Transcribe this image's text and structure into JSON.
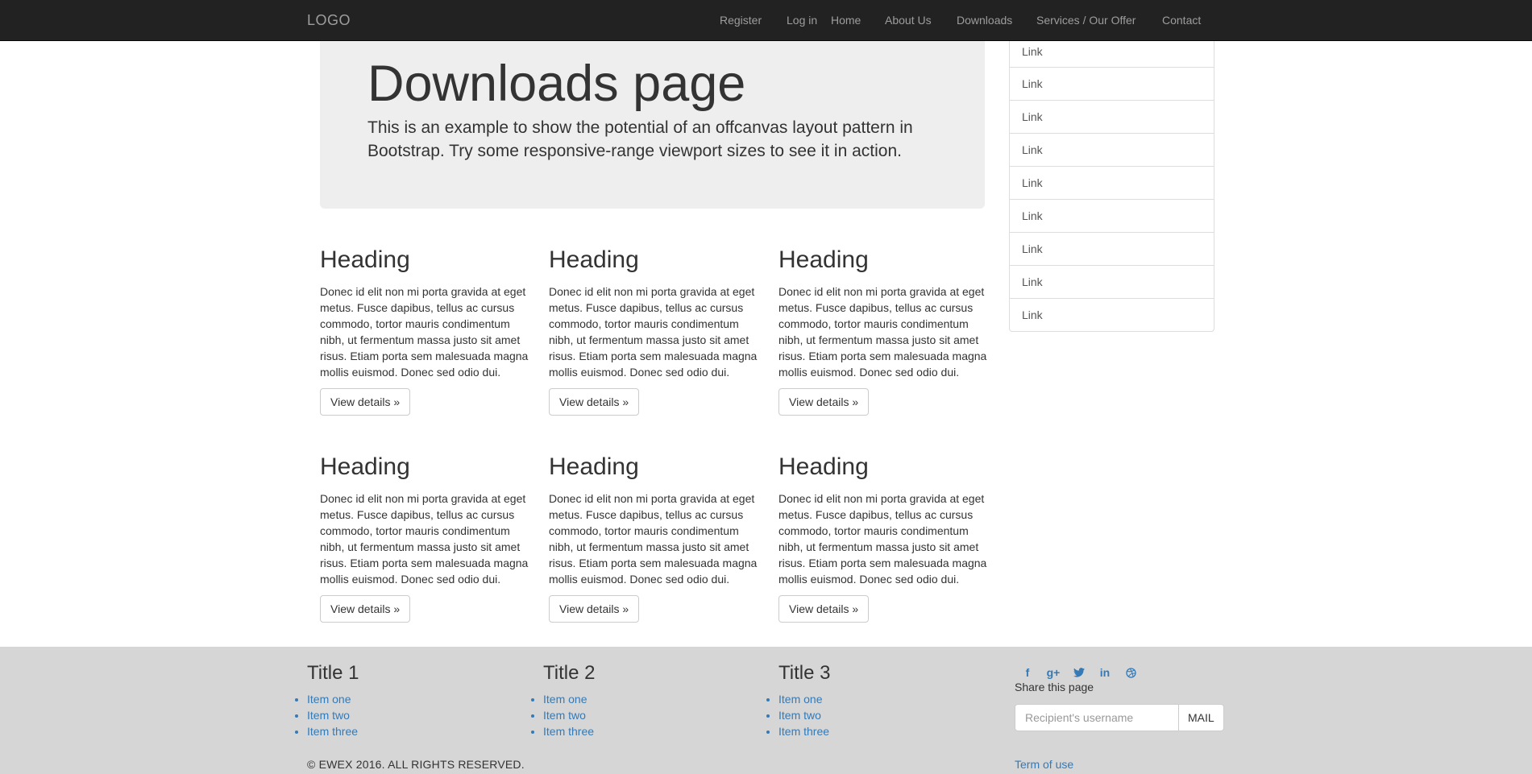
{
  "navbar": {
    "brand": "LOGO",
    "links": [
      "Register",
      "Log in",
      "Home",
      "About Us",
      "Downloads",
      "Services / Our Offer",
      "Contact"
    ]
  },
  "jumbotron": {
    "title": "Downloads page",
    "lead": "This is an example to show the potential of an offcanvas layout pattern in Bootstrap. Try some responsive-range viewport sizes to see it in action."
  },
  "sidebar": {
    "items": [
      "Link",
      "Link",
      "Link",
      "Link",
      "Link",
      "Link",
      "Link",
      "Link",
      "Link"
    ]
  },
  "cards": [
    {
      "heading": "Heading",
      "text": "Donec id elit non mi porta gravida at eget metus. Fusce dapibus, tellus ac cursus commodo, tortor mauris condimentum nibh, ut fermentum massa justo sit amet risus. Etiam porta sem malesuada magna mollis euismod. Donec sed odio dui.",
      "button": "View details »"
    },
    {
      "heading": "Heading",
      "text": "Donec id elit non mi porta gravida at eget metus. Fusce dapibus, tellus ac cursus commodo, tortor mauris condimentum nibh, ut fermentum massa justo sit amet risus. Etiam porta sem malesuada magna mollis euismod. Donec sed odio dui.",
      "button": "View details »"
    },
    {
      "heading": "Heading",
      "text": "Donec id elit non mi porta gravida at eget metus. Fusce dapibus, tellus ac cursus commodo, tortor mauris condimentum nibh, ut fermentum massa justo sit amet risus. Etiam porta sem malesuada magna mollis euismod. Donec sed odio dui.",
      "button": "View details »"
    },
    {
      "heading": "Heading",
      "text": "Donec id elit non mi porta gravida at eget metus. Fusce dapibus, tellus ac cursus commodo, tortor mauris condimentum nibh, ut fermentum massa justo sit amet risus. Etiam porta sem malesuada magna mollis euismod. Donec sed odio dui.",
      "button": "View details »"
    },
    {
      "heading": "Heading",
      "text": "Donec id elit non mi porta gravida at eget metus. Fusce dapibus, tellus ac cursus commodo, tortor mauris condimentum nibh, ut fermentum massa justo sit amet risus. Etiam porta sem malesuada magna mollis euismod. Donec sed odio dui.",
      "button": "View details »"
    },
    {
      "heading": "Heading",
      "text": "Donec id elit non mi porta gravida at eget metus. Fusce dapibus, tellus ac cursus commodo, tortor mauris condimentum nibh, ut fermentum massa justo sit amet risus. Etiam porta sem malesuada magna mollis euismod. Donec sed odio dui.",
      "button": "View details »"
    }
  ],
  "footer": {
    "columns": [
      {
        "title": "Title 1",
        "items": [
          "Item one",
          "Item two",
          "Item three"
        ]
      },
      {
        "title": "Title 2",
        "items": [
          "Item one",
          "Item two",
          "Item three"
        ]
      },
      {
        "title": "Title 3",
        "items": [
          "Item one",
          "Item two",
          "Item three"
        ]
      }
    ],
    "social_icons": [
      "facebook-icon",
      "google-plus-icon",
      "twitter-icon",
      "linkedin-icon",
      "dribbble-icon"
    ],
    "share_label": "Share this page",
    "mail_placeholder": "Recipient's username",
    "mail_button": "MAIL",
    "copyright": "© EWEX 2016. ALL RIGHTS RESERVED.",
    "terms": "Term of use"
  },
  "colors": {
    "navbar_bg": "#222222",
    "nav_text": "#9d9d9d",
    "jumbotron_bg": "#eeeeee",
    "footer_bg": "#d6d6d6",
    "link": "#337ab7"
  }
}
